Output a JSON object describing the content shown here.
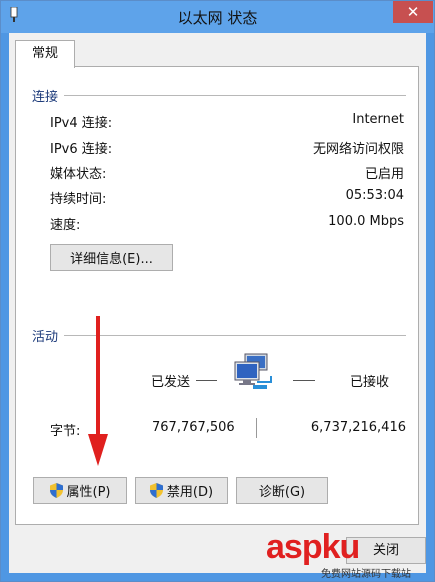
{
  "window": {
    "title": "以太网 状态",
    "close_label": "✕"
  },
  "tabs": [
    {
      "label": "常规"
    }
  ],
  "connection": {
    "group_label": "连接",
    "rows": [
      {
        "label": "IPv4 连接:",
        "value": "Internet"
      },
      {
        "label": "IPv6 连接:",
        "value": "无网络访问权限"
      },
      {
        "label": "媒体状态:",
        "value": "已启用"
      },
      {
        "label": "持续时间:",
        "value": "05:53:04"
      },
      {
        "label": "速度:",
        "value": "100.0 Mbps"
      }
    ],
    "details_button": "详细信息(E)..."
  },
  "activity": {
    "group_label": "活动",
    "sent_label": "已发送",
    "received_label": "已接收",
    "bytes_label": "字节:",
    "bytes_sent": "767,767,506",
    "bytes_received": "6,737,216,416"
  },
  "actions": {
    "properties": "属性(P)",
    "disable": "禁用(D)",
    "diagnose": "诊断(G)"
  },
  "footer": {
    "close_button": "关闭"
  },
  "watermark": {
    "text": "aspku",
    "subtext": "免费网站源码下载站"
  },
  "colors": {
    "titlebar": "#5ea3ea",
    "close": "#c75050",
    "annotation_arrow": "#e0201e",
    "group_label": "#1c3a7a"
  },
  "icons": [
    "ethernet-icon",
    "shield-icon",
    "network-computers-icon"
  ]
}
